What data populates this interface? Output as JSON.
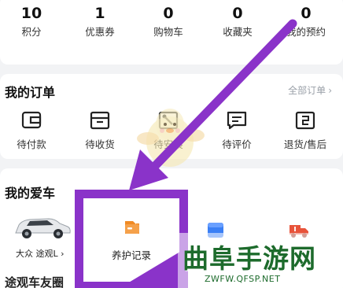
{
  "stats": [
    {
      "value": "10",
      "label": "积分"
    },
    {
      "value": "1",
      "label": "优惠券"
    },
    {
      "value": "0",
      "label": "购物车"
    },
    {
      "value": "0",
      "label": "收藏夹"
    },
    {
      "value": "0",
      "label": "我的预约"
    }
  ],
  "orders": {
    "title": "我的订单",
    "all_label": "全部订单",
    "all_chevron": "›",
    "items": [
      {
        "label": "待付款",
        "icon": "wallet-icon"
      },
      {
        "label": "待收货",
        "icon": "package-icon"
      },
      {
        "label": "待安装",
        "icon": "wrench-icon"
      },
      {
        "label": "待评价",
        "icon": "comment-icon"
      },
      {
        "label": "退货/售后",
        "icon": "return-icon"
      }
    ]
  },
  "car": {
    "title": "我的爱车",
    "name": "大众 途观L",
    "chevron": "›",
    "highlight_label": "养护记录"
  },
  "community": {
    "title": "途观车友圈"
  },
  "watermark": {
    "text": "曲阜手游网",
    "url": "ZWFW.QFSP.NET"
  },
  "colors": {
    "accent_purple": "#8a33c9",
    "orange": "#f08a24",
    "blue": "#3a7ff5",
    "red": "#e8533a",
    "watermark_green": "#1d6b2c"
  }
}
